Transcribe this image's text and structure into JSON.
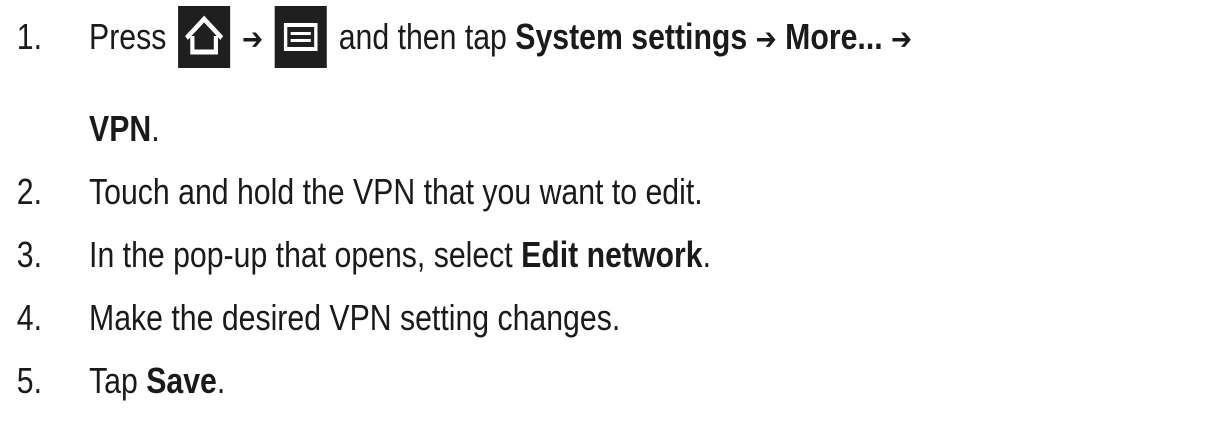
{
  "steps": [
    {
      "number": "1.",
      "parts": {
        "press": "Press",
        "arrow1": "➔",
        "and_then": "and then tap",
        "system_settings": "System settings",
        "arrow2": "➔",
        "more": "More...",
        "arrow3": "➔",
        "vpn": "VPN",
        "end": "."
      },
      "icons": [
        "home-key",
        "menu-key"
      ]
    },
    {
      "number": "2.",
      "text": "Touch and hold the VPN that you want to edit."
    },
    {
      "number": "3.",
      "text_before": "In the pop-up that opens, select",
      "bold": "Edit network",
      "text_after": "."
    },
    {
      "number": "4.",
      "text": "Make the desired VPN setting changes."
    },
    {
      "number": "5.",
      "text_before": "Tap",
      "bold": "Save",
      "text_after": "."
    }
  ]
}
